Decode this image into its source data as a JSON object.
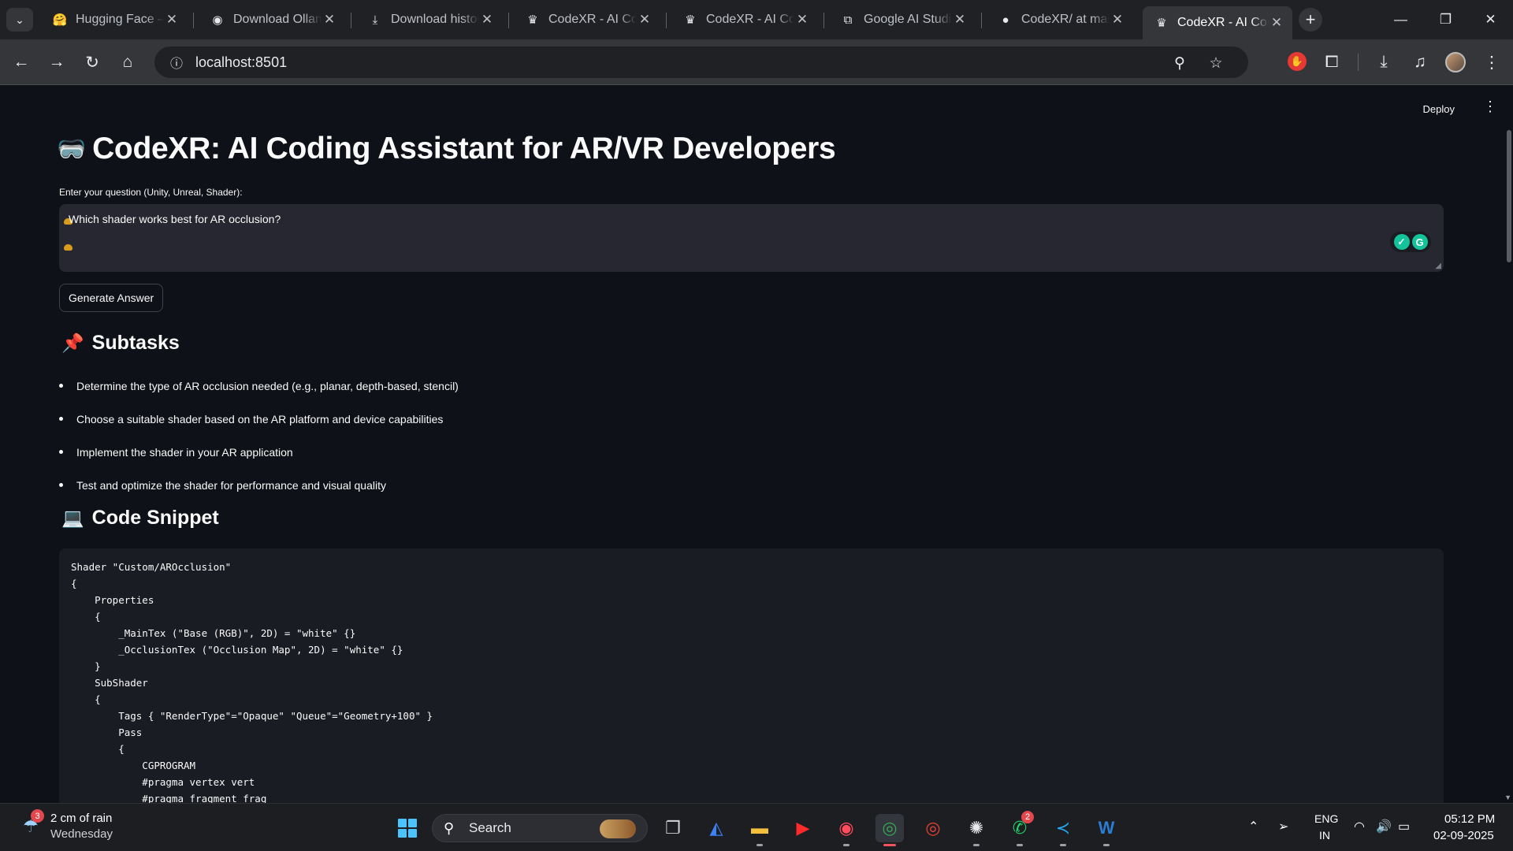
{
  "browser": {
    "tabs": [
      {
        "title": "Hugging Face – T",
        "icon": "hugging-face-icon"
      },
      {
        "title": "Download Ollam",
        "icon": "ollama-icon"
      },
      {
        "title": "Download histor",
        "icon": "download-icon"
      },
      {
        "title": "CodeXR - AI Cod",
        "icon": "streamlit-crown-icon"
      },
      {
        "title": "CodeXR - AI Cod",
        "icon": "streamlit-crown-icon"
      },
      {
        "title": "Google AI Studi",
        "icon": "ai-studio-icon"
      },
      {
        "title": "CodeXR/ at main",
        "icon": "github-icon"
      },
      {
        "title": "CodeXR - AI Cod",
        "icon": "streamlit-crown-icon",
        "active": true
      }
    ],
    "url": "localhost:8501"
  },
  "app": {
    "deploy_label": "Deploy",
    "title_emoji": "🥽",
    "title": "CodeXR: AI Coding Assistant for AR/VR Developers",
    "question_label": "Enter your question (Unity, Unreal, Shader):",
    "question_value": "Which shader works best for AR occlusion?",
    "generate_label": "Generate Answer",
    "subtasks_emoji": "📌",
    "subtasks_heading": "Subtasks",
    "subtasks": [
      "Determine the type of AR occlusion needed (e.g., planar, depth-based, stencil)",
      "Choose a suitable shader based on the AR platform and device capabilities",
      "Implement the shader in your AR application",
      "Test and optimize the shader for performance and visual quality"
    ],
    "code_emoji": "💻",
    "code_heading": "Code Snippet",
    "code_lines": [
      "Shader \"Custom/AROcclusion\"",
      "{",
      "    Properties",
      "    {",
      "        _MainTex (\"Base (RGB)\", 2D) = \"white\" {}",
      "        _OcclusionTex (\"Occlusion Map\", 2D) = \"white\" {}",
      "    }",
      "    SubShader",
      "    {",
      "        Tags { \"RenderType\"=\"Opaque\" \"Queue\"=\"Geometry+100\" }",
      "        Pass",
      "        {",
      "            CGPROGRAM",
      "            #pragma vertex vert",
      "            #pragma fragment frag"
    ]
  },
  "taskbar": {
    "weather_text": "2 cm of rain",
    "weather_day": "Wednesday",
    "weather_badge": "3",
    "search_label": "Search",
    "chatgpt_badge": "",
    "whatsapp_badge": "2",
    "lang_1": "ENG",
    "lang_2": "IN",
    "time": "05:12 PM",
    "date": "02-09-2025"
  }
}
